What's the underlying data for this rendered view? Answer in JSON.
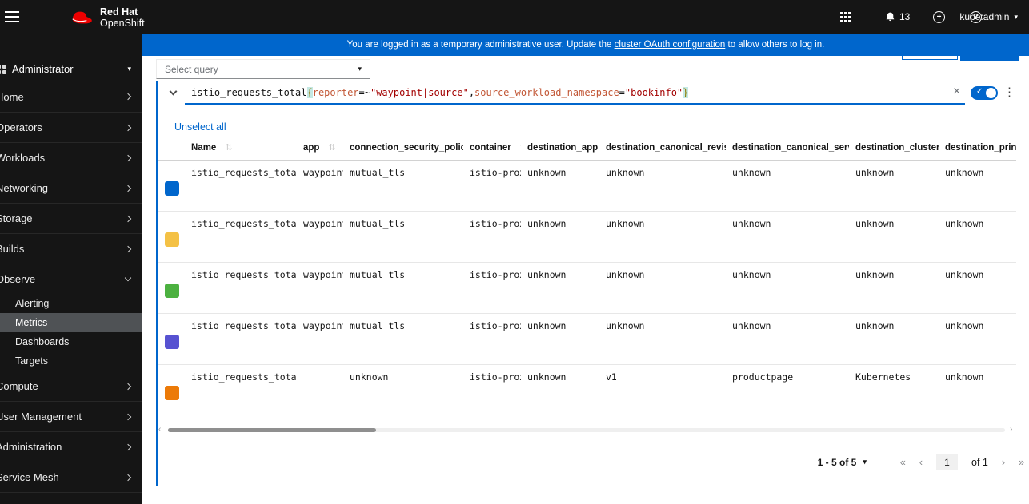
{
  "masthead": {
    "brand_line1": "Red Hat",
    "brand_line2": "OpenShift",
    "notification_count": "13",
    "user_menu": "kube:admin"
  },
  "banner": {
    "text_before": "You are logged in as a temporary administrative user. Update the ",
    "link_text": "cluster OAuth configuration",
    "text_after": " to allow others to log in."
  },
  "sidebar": {
    "perspective": "Administrator",
    "items": [
      {
        "label": "Home",
        "state": "collapsed"
      },
      {
        "label": "Operators",
        "state": "collapsed"
      },
      {
        "label": "Workloads",
        "state": "collapsed"
      },
      {
        "label": "Networking",
        "state": "collapsed"
      },
      {
        "label": "Storage",
        "state": "collapsed"
      },
      {
        "label": "Builds",
        "state": "collapsed"
      },
      {
        "label": "Observe",
        "state": "expanded",
        "children": [
          {
            "label": "Alerting",
            "active": false
          },
          {
            "label": "Metrics",
            "active": true
          },
          {
            "label": "Dashboards",
            "active": false
          },
          {
            "label": "Targets",
            "active": false
          }
        ]
      },
      {
        "label": "Compute",
        "state": "collapsed"
      },
      {
        "label": "User Management",
        "state": "collapsed"
      },
      {
        "label": "Administration",
        "state": "collapsed"
      },
      {
        "label": "Service Mesh",
        "state": "collapsed"
      }
    ]
  },
  "toolbar": {
    "select_query_label": "Select query"
  },
  "query": {
    "expression": "istio_requests_total{reporter=~\"waypoint|source\",source_workload_namespace=\"bookinfo\"}",
    "segments": [
      {
        "text": "istio_requests_total",
        "type": "metric"
      },
      {
        "text": "{",
        "type": "brace"
      },
      {
        "text": "reporter",
        "type": "label"
      },
      {
        "text": "=~",
        "type": "op"
      },
      {
        "text": "\"waypoint|source\"",
        "type": "string"
      },
      {
        "text": ",",
        "type": "op"
      },
      {
        "text": "source_workload_namespace",
        "type": "label"
      },
      {
        "text": "=",
        "type": "op"
      },
      {
        "text": "\"bookinfo\"",
        "type": "string"
      },
      {
        "text": "}",
        "type": "brace"
      }
    ],
    "enabled_toggle_on": true
  },
  "series_table": {
    "unselect_all_label": "Unselect all",
    "columns": [
      "Name",
      "app",
      "connection_security_policy",
      "container",
      "destination_app",
      "destination_canonical_revision",
      "destination_canonical_service",
      "destination_cluster",
      "destination_principal"
    ],
    "rows": [
      {
        "swatch_color": "#0066cc",
        "cells": [
          "istio_requests_total",
          "waypoint",
          "mutual_tls",
          "istio-proxy",
          "unknown",
          "unknown",
          "unknown",
          "unknown",
          "unknown"
        ]
      },
      {
        "swatch_color": "#f4c145",
        "cells": [
          "istio_requests_total",
          "waypoint",
          "mutual_tls",
          "istio-proxy",
          "unknown",
          "unknown",
          "unknown",
          "unknown",
          "unknown"
        ]
      },
      {
        "swatch_color": "#4cb140",
        "cells": [
          "istio_requests_total",
          "waypoint",
          "mutual_tls",
          "istio-proxy",
          "unknown",
          "unknown",
          "unknown",
          "unknown",
          "unknown"
        ]
      },
      {
        "swatch_color": "#5752d1",
        "cells": [
          "istio_requests_total",
          "waypoint",
          "mutual_tls",
          "istio-proxy",
          "unknown",
          "unknown",
          "unknown",
          "unknown",
          "unknown"
        ]
      },
      {
        "swatch_color": "#ec7a08",
        "cells": [
          "istio_requests_total",
          "",
          "unknown",
          "istio-proxy",
          "unknown",
          "v1",
          "productpage",
          "Kubernetes",
          "unknown"
        ]
      }
    ]
  },
  "pagination": {
    "range_label": "1 - 5 of 5",
    "page": "1",
    "of_label": "of 1"
  },
  "colors": {
    "accent_blue": "#0066cc",
    "masthead_bg": "#151515",
    "selected_nav_bg": "#4f5255"
  }
}
